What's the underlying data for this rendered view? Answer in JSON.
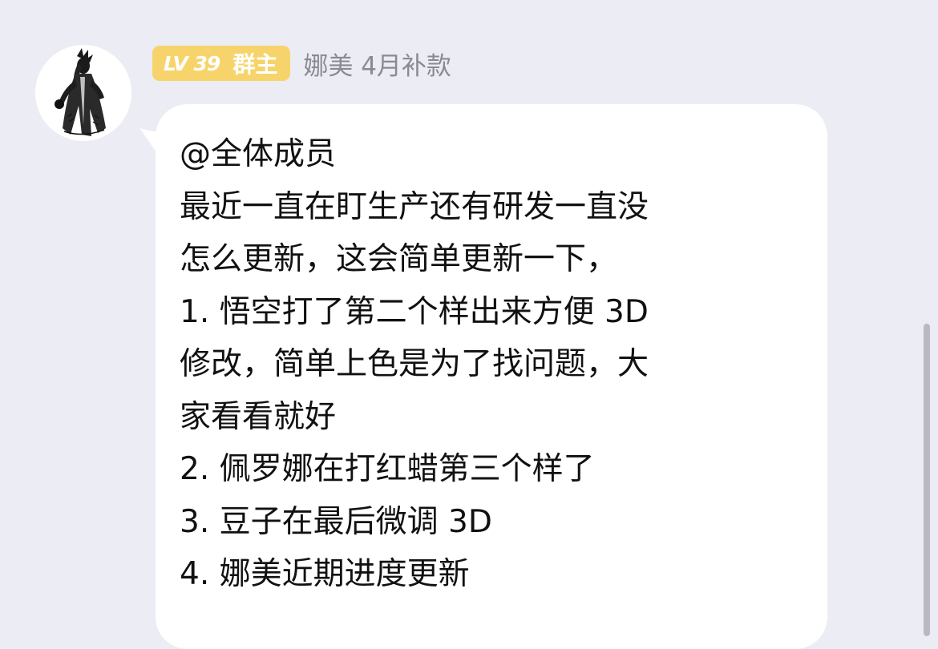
{
  "chat": {
    "sender": {
      "level_badge": "LV 39",
      "role_badge": "群主",
      "name": "娜美 4月补款",
      "avatar": "ink-sketch-character-avatar"
    },
    "message": {
      "lines": [
        "@全体成员",
        "最近一直在盯生产还有研发一直没",
        "怎么更新，这会简单更新一下，",
        "1. 悟空打了第二个样出来方便 3D",
        "修改，简单上色是为了找问题，大",
        "家看看就好",
        "2. 佩罗娜在打红蜡第三个样了",
        "3. 豆子在最后微调 3D",
        "4. 娜美近期进度更新"
      ]
    }
  },
  "colors": {
    "background": "#ececf4",
    "bubble": "#ffffff",
    "badge": "#f7d46b",
    "sender_text": "#8a8a92",
    "message_text": "#111111"
  }
}
